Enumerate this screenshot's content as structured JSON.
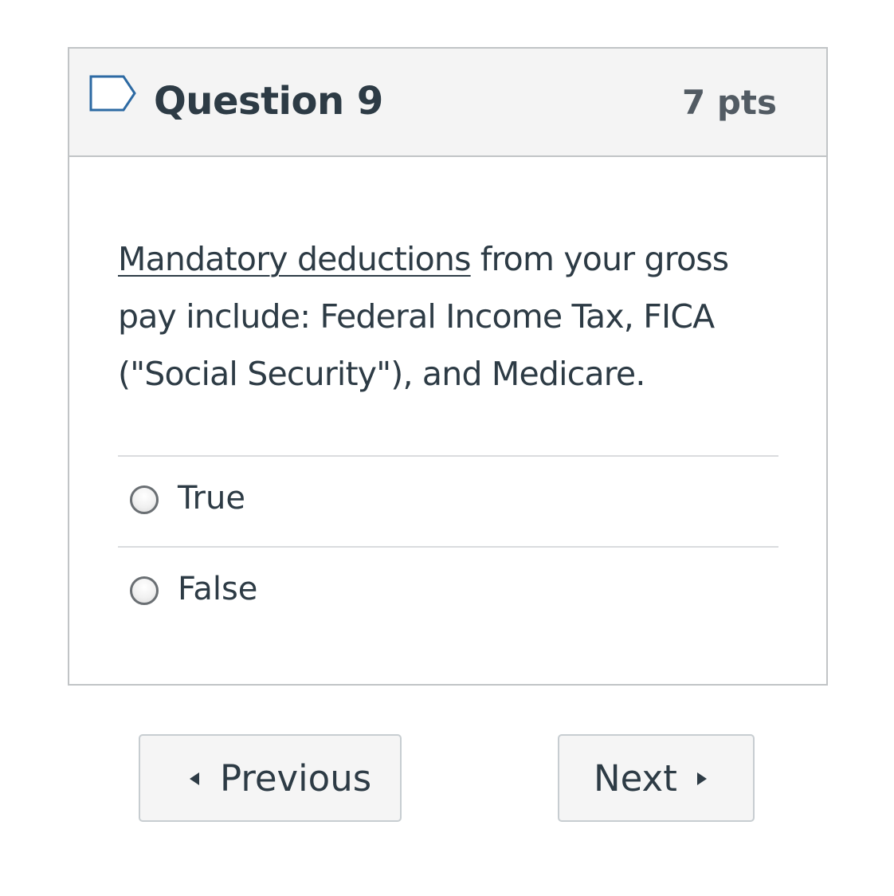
{
  "question": {
    "title": "Question 9",
    "points": "7 pts",
    "text_underlined": "Mandatory deductions",
    "text_rest": " from your gross pay include: Federal Income Tax, FICA (\"Social Security\"), and Medicare.",
    "answers": [
      {
        "label": "True"
      },
      {
        "label": "False"
      }
    ]
  },
  "navigation": {
    "previous_label": "Previous",
    "next_label": "Next"
  },
  "colors": {
    "header_background": "#f4f4f4",
    "text": "#2d3b45",
    "border": "#c1c4c6",
    "flag_outline": "#2d6aa3"
  }
}
